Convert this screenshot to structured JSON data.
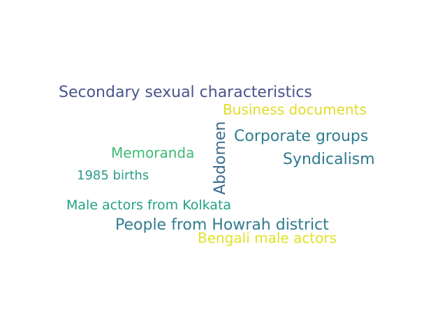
{
  "words": [
    {
      "text": "Secondary sexual characteristics",
      "color": "#46568c"
    },
    {
      "text": "Business documents",
      "color": "#e1dc2a"
    },
    {
      "text": "Corporate groups",
      "color": "#2f7e8e"
    },
    {
      "text": "Syndicalism",
      "color": "#2e7a8e"
    },
    {
      "text": "Memoranda",
      "color": "#3dba72"
    },
    {
      "text": "1985 births",
      "color": "#2a9c8b"
    },
    {
      "text": "Male actors from Kolkata",
      "color": "#24a085"
    },
    {
      "text": "People from Howrah district",
      "color": "#327b8f"
    },
    {
      "text": "Bengali male actors",
      "color": "#e1e229"
    },
    {
      "text": "Abdomen",
      "color": "#3b6a8c"
    }
  ]
}
